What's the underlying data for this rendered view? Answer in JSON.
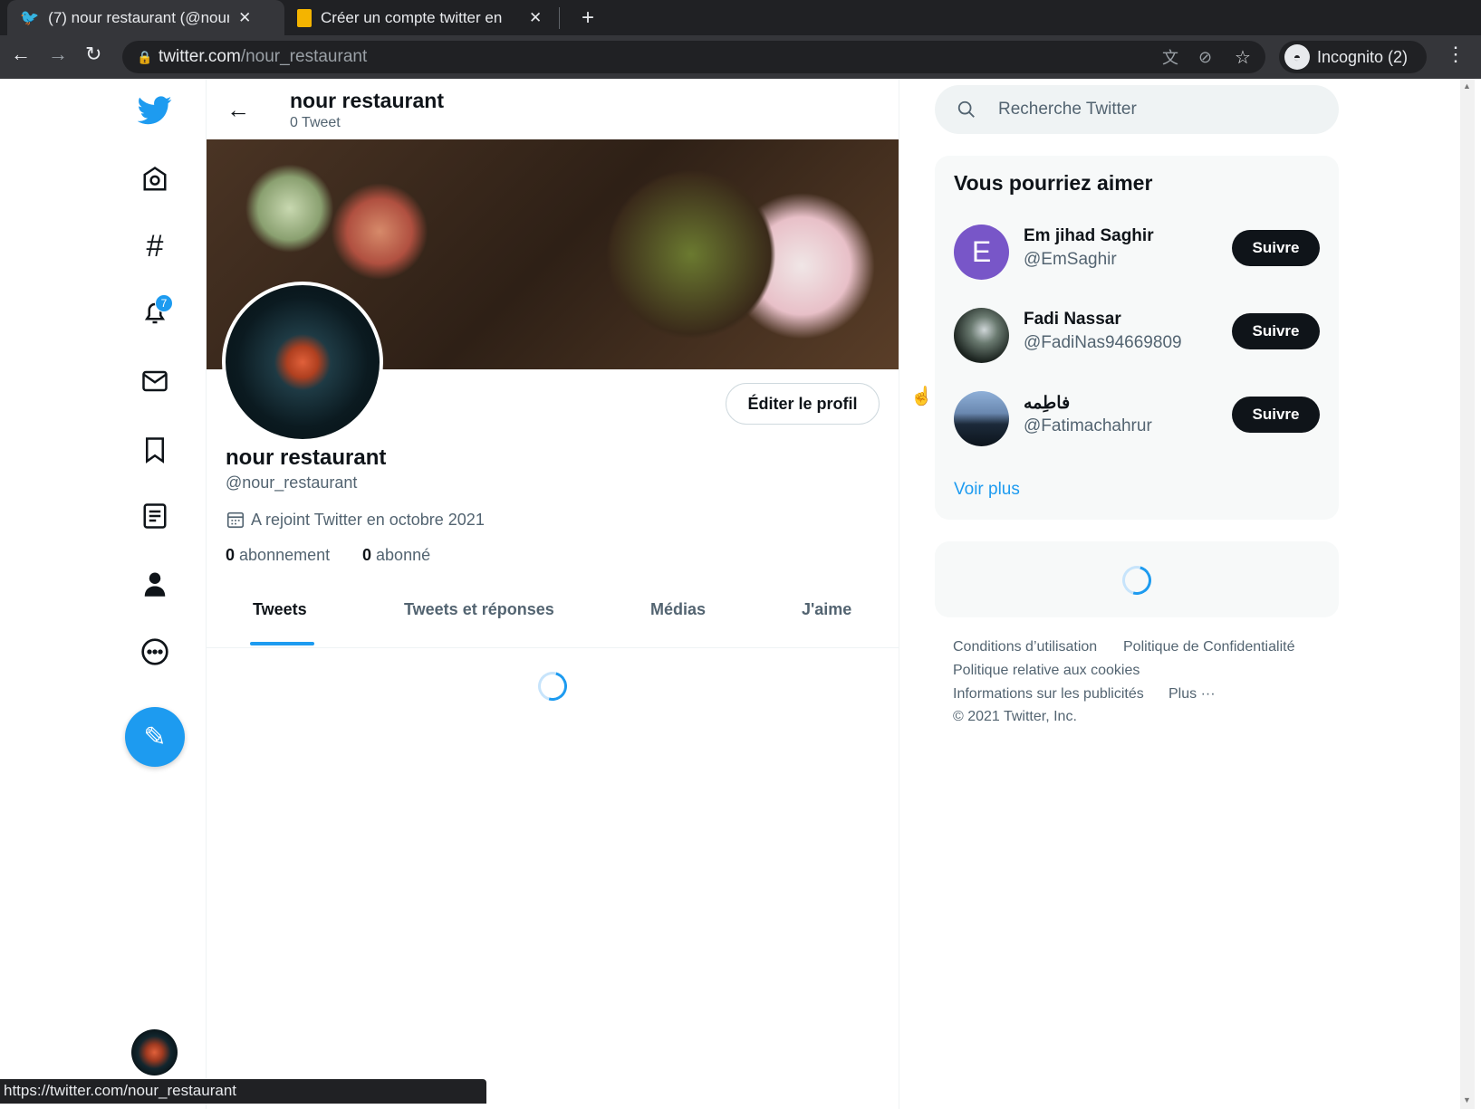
{
  "browser": {
    "tabs": [
      {
        "title": "(7) nour restaurant (@nour_restaurant)"
      },
      {
        "title": "Créer un compte twitter en"
      }
    ],
    "new_tab": "+",
    "url_host": "twitter.com",
    "url_path": "/nour_restaurant",
    "incognito": "Incognito (2)",
    "status_url": "https://twitter.com/nour_restaurant"
  },
  "nav": {
    "notifications_badge": "7",
    "items": [
      "home",
      "explore",
      "notifications",
      "messages",
      "bookmarks",
      "lists",
      "profile",
      "more"
    ]
  },
  "header": {
    "title": "nour restaurant",
    "subtitle": "0 Tweet"
  },
  "profile": {
    "name": "nour restaurant",
    "handle": "@nour_restaurant",
    "joined": "A rejoint Twitter en octobre 2021",
    "following_count": "0",
    "following_label": "abonnement",
    "followers_count": "0",
    "followers_label": "abonné",
    "edit_label": "Éditer le profil"
  },
  "tabs": [
    {
      "label": "Tweets",
      "active": true
    },
    {
      "label": "Tweets et réponses"
    },
    {
      "label": "Médias"
    },
    {
      "label": "J'aime"
    }
  ],
  "search": {
    "placeholder": "Recherche Twitter"
  },
  "suggestions": {
    "title": "Vous pourriez aimer",
    "items": [
      {
        "name": "Em jihad Saghir",
        "handle": "@EmSaghir",
        "initial": "E"
      },
      {
        "name": "Fadi Nassar",
        "handle": "@FadiNas94669809"
      },
      {
        "name": "فاطِمه",
        "handle": "@Fatimachahrur"
      }
    ],
    "follow_label": "Suivre",
    "more": "Voir plus"
  },
  "footer": {
    "links": [
      "Conditions d’utilisation",
      "Politique de Confidentialité",
      "Politique relative aux cookies",
      "Informations sur les publicités",
      "Plus ···"
    ],
    "copyright": "© 2021 Twitter, Inc."
  },
  "colors": {
    "accent": "#1d9bf0",
    "avatar_purple": "#7856c8"
  }
}
